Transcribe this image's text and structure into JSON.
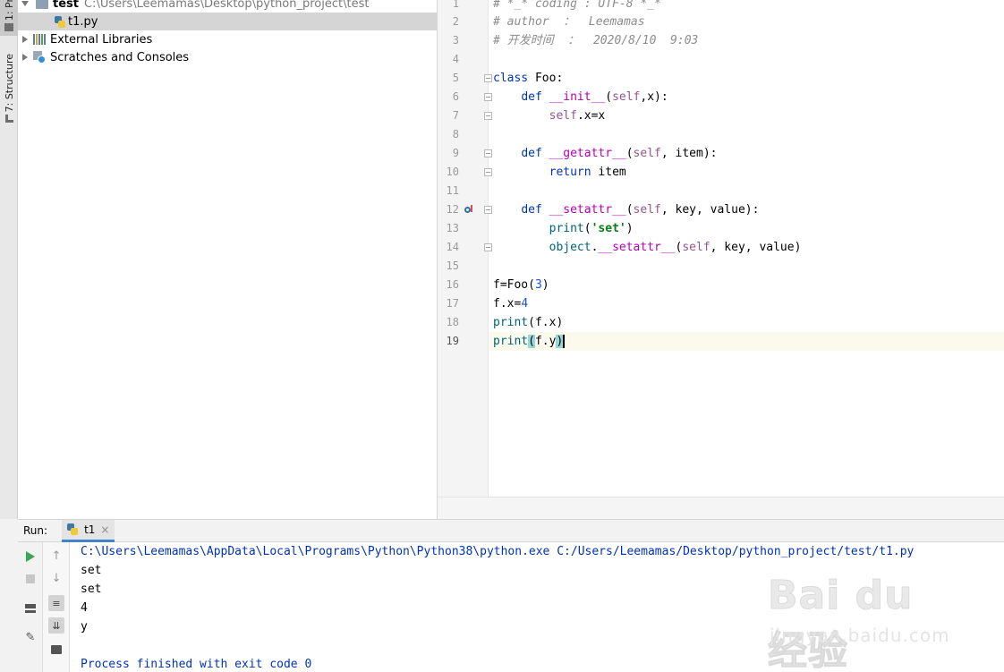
{
  "tool_windows": {
    "project_tab": "1: Pr",
    "structure_tab": "7: Structure"
  },
  "project_tree": {
    "root": {
      "name": "test",
      "path": "C:\\Users\\Leemamas\\Desktop\\python_project\\test"
    },
    "file": "t1.py",
    "external_libraries": "External Libraries",
    "scratches": "Scratches and Consoles"
  },
  "editor": {
    "line_numbers": [
      "1",
      "2",
      "3",
      "4",
      "5",
      "6",
      "7",
      "8",
      "9",
      "10",
      "11",
      "12",
      "13",
      "14",
      "15",
      "16",
      "17",
      "18",
      "19"
    ],
    "comment_coding": "# *_* coding : UTF-8 *_*",
    "comment_author": "# author  ：  Leemamas",
    "comment_time": "# 开发时间  ：  2020/8/10  9:03",
    "current_line": 19
  },
  "run_panel": {
    "title": "Run:",
    "tab": "t1",
    "close_symbol": "×",
    "output": {
      "command": "C:\\Users\\Leemamas\\AppData\\Local\\Programs\\Python\\Python38\\python.exe C:/Users/Leemamas/Desktop/python_project/test/t1.py",
      "line1": "set",
      "line2": "set",
      "line3": "4",
      "line4": "y",
      "finished": "Process finished with exit code 0"
    }
  },
  "watermark": {
    "logo": "Bai du 经验",
    "url": "jingyan.baidu.com"
  }
}
